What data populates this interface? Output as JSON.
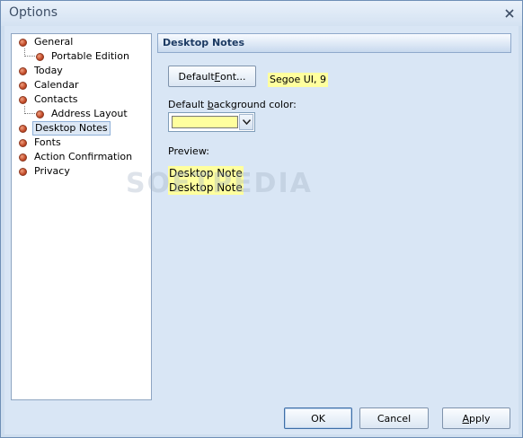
{
  "window": {
    "title": "Options"
  },
  "tree": {
    "items": [
      {
        "label": "General"
      },
      {
        "label": "Portable Edition"
      },
      {
        "label": "Today"
      },
      {
        "label": "Calendar"
      },
      {
        "label": "Contacts"
      },
      {
        "label": "Address Layout"
      },
      {
        "label": "Desktop Notes",
        "selected": true
      },
      {
        "label": "Fonts"
      },
      {
        "label": "Action Confirmation"
      },
      {
        "label": "Privacy"
      }
    ]
  },
  "panel": {
    "title": "Desktop Notes",
    "default_font_button": {
      "before": "Default ",
      "underlined": "F",
      "after": "ont..."
    },
    "current_font": "Segoe UI, 9",
    "bg_color_label": {
      "before": "Default ",
      "underlined": "b",
      "after": "ackground color:"
    },
    "bg_color_value": "#ffff9e",
    "preview_label": "Preview:",
    "preview_lines": [
      "Desktop Note",
      "Desktop Note"
    ],
    "watermark": "SOFTPEDIA"
  },
  "footer": {
    "ok": "OK",
    "cancel": "Cancel",
    "apply": {
      "underlined": "A",
      "after": "pply"
    }
  }
}
